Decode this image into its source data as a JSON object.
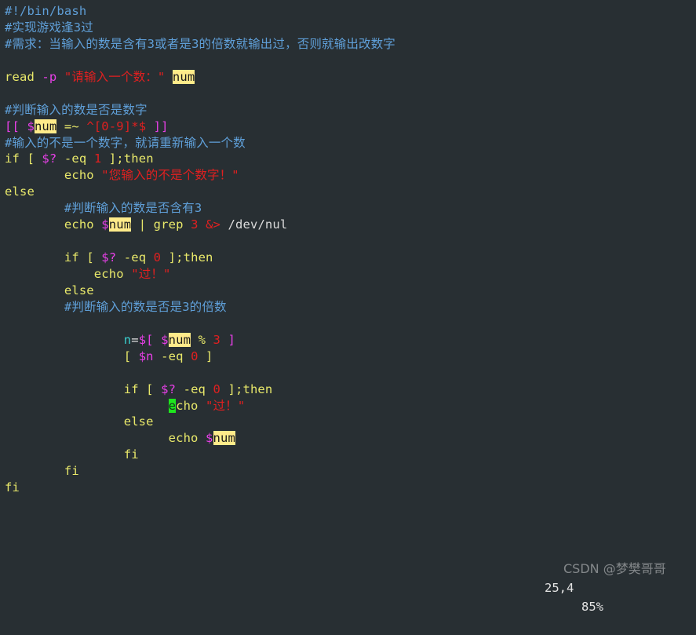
{
  "editor": {
    "background_color": "#282f33",
    "filetype": "bash",
    "colors": {
      "comment": "#5f9fd8",
      "keyword": "#e8e86a",
      "string": "#e02020",
      "number": "#e02020",
      "variable": "#e840e8",
      "plain": "#dcdcdc",
      "search_highlight_bg": "#ffeb8a",
      "cursor_bg": "#1ee61e"
    }
  },
  "code_lines": [
    {
      "n": 1,
      "indent": 0,
      "text": "#!/bin/bash"
    },
    {
      "n": 2,
      "indent": 0,
      "text": "#实现游戏逢3过"
    },
    {
      "n": 3,
      "indent": 0,
      "text": "#需求：当输入的数是含有3或者是3的倍数就输出过，否则就输出改数字"
    },
    {
      "n": 4,
      "indent": 0,
      "text": ""
    },
    {
      "n": 5,
      "indent": 0,
      "text": "read -p \"请输入一个数：\" num"
    },
    {
      "n": 6,
      "indent": 0,
      "text": ""
    },
    {
      "n": 7,
      "indent": 0,
      "text": "#判断输入的数是否是数字"
    },
    {
      "n": 8,
      "indent": 0,
      "text": "[[ $num =~ ^[0-9]*$ ]]"
    },
    {
      "n": 9,
      "indent": 0,
      "text": "#输入的不是一个数字，就请重新输入一个数"
    },
    {
      "n": 10,
      "indent": 0,
      "text": "if [ $? -eq 1 ];then"
    },
    {
      "n": 11,
      "indent": 8,
      "text": "echo \"您输入的不是个数字！\""
    },
    {
      "n": 12,
      "indent": 0,
      "text": "else"
    },
    {
      "n": 13,
      "indent": 8,
      "text": "#判断输入的数是否含有3"
    },
    {
      "n": 14,
      "indent": 8,
      "text": "echo $num | grep 3 &> /dev/nul"
    },
    {
      "n": 15,
      "indent": 0,
      "text": ""
    },
    {
      "n": 16,
      "indent": 8,
      "text": "if [ $? -eq 0 ];then"
    },
    {
      "n": 17,
      "indent": 12,
      "text": "echo \"过！\""
    },
    {
      "n": 18,
      "indent": 8,
      "text": "else"
    },
    {
      "n": 19,
      "indent": 8,
      "text": "#判断输入的数是否是3的倍数"
    },
    {
      "n": 20,
      "indent": 0,
      "text": ""
    },
    {
      "n": 21,
      "indent": 16,
      "text": "n=$[ $num % 3 ]"
    },
    {
      "n": 22,
      "indent": 16,
      "text": "[ $n -eq 0 ]"
    },
    {
      "n": 23,
      "indent": 0,
      "text": ""
    },
    {
      "n": 24,
      "indent": 16,
      "text": "if [ $? -eq 0 ];then"
    },
    {
      "n": 25,
      "indent": 22,
      "text": "echo \"过！\""
    },
    {
      "n": 26,
      "indent": 16,
      "text": "else"
    },
    {
      "n": 27,
      "indent": 22,
      "text": "echo $num"
    },
    {
      "n": 28,
      "indent": 16,
      "text": "fi"
    },
    {
      "n": 29,
      "indent": 8,
      "text": "fi"
    },
    {
      "n": 30,
      "indent": 0,
      "text": "fi"
    }
  ],
  "tokens": {
    "shebang": "#!/bin/bash",
    "comment_2": "#实现游戏逢3过",
    "comment_3": "#需求：当输入的数是含有3或者是3的倍数就输出过，否则就输出改数字",
    "comment_7": "#判断输入的数是否是数字",
    "comment_9": "#输入的不是一个数字，就请重新输入一个数",
    "comment_13": "#判断输入的数是否含有3",
    "comment_19": "#判断输入的数是否是3的倍数",
    "read": "read",
    "opt_p": "-p",
    "prompt_string": "\"请输入一个数：\"",
    "var_num_plain": "num",
    "dbl_open": "[[",
    "dbl_close": "]]",
    "dollar": "$",
    "num_hl": "num",
    "regex_match_op": "=~",
    "regex": "^[0-9]*$",
    "if": "if",
    "bracket_open": "[",
    "bracket_close": "]",
    "status_var": "$?",
    "eq": "-eq",
    "one": "1",
    "zero": "0",
    "three": "3",
    "semi_then": ";then",
    "echo": "echo",
    "else": "else",
    "fi": "fi",
    "err_string": "\"您输入的不是个数字！\"",
    "pass_string": "\"过！\"",
    "pipe": "|",
    "grep": "grep",
    "redirect_all": "&>",
    "devnul": "/dev/nul",
    "n_var": "n",
    "assign": "=",
    "arith_open": "$[",
    "arith_close": "]",
    "percent": "%",
    "dollar_n": "$n",
    "cursor_char": "e",
    "echo_rest": "cho"
  },
  "ruler": {
    "position": "25,4",
    "percent": "85%"
  },
  "watermark": {
    "text": "CSDN @梦樊哥哥"
  }
}
